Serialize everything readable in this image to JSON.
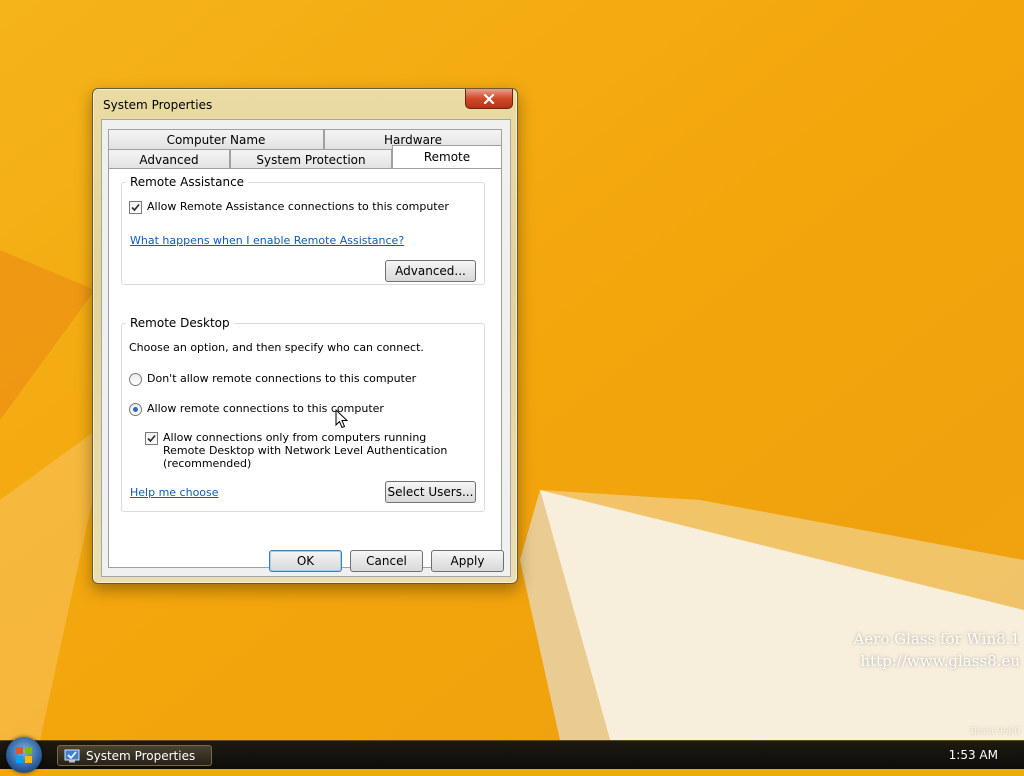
{
  "window": {
    "title": "System Properties",
    "tabs_row1": [
      "Computer Name",
      "Hardware"
    ],
    "tabs_row2": [
      "Advanced",
      "System Protection",
      "Remote"
    ],
    "active_tab": "Remote"
  },
  "remote_assistance": {
    "legend": "Remote Assistance",
    "allow_checkbox_label": "Allow Remote Assistance connections to this computer",
    "allow_checked": true,
    "help_link": "What happens when I enable Remote Assistance?",
    "advanced_button": "Advanced..."
  },
  "remote_desktop": {
    "legend": "Remote Desktop",
    "instruction": "Choose an option, and then specify who can connect.",
    "option_dont_allow": "Don't allow remote connections to this computer",
    "option_allow": "Allow remote connections to this computer",
    "selected_option": "allow",
    "nla_checkbox_label": "Allow connections only from computers running Remote Desktop with Network Level Authentication (recommended)",
    "nla_checked": true,
    "help_link": "Help me choose",
    "select_users_button": "Select Users..."
  },
  "footer": {
    "ok": "OK",
    "cancel": "Cancel",
    "apply": "Apply"
  },
  "taskbar": {
    "item_label": "System Properties",
    "clock": "1:53 AM"
  },
  "watermark": {
    "line1": "Aero Glass for Win8.1",
    "line2": "http://www.glass8.eu",
    "build": "Build 9600"
  },
  "colors": {
    "desktop": "#f3a70e",
    "link": "#0b5cb6",
    "close": "#cf4a2a"
  },
  "icons": {
    "start": "windows-start-orb",
    "task": "system-properties-icon",
    "close": "close-icon",
    "check": "checkmark-icon"
  }
}
